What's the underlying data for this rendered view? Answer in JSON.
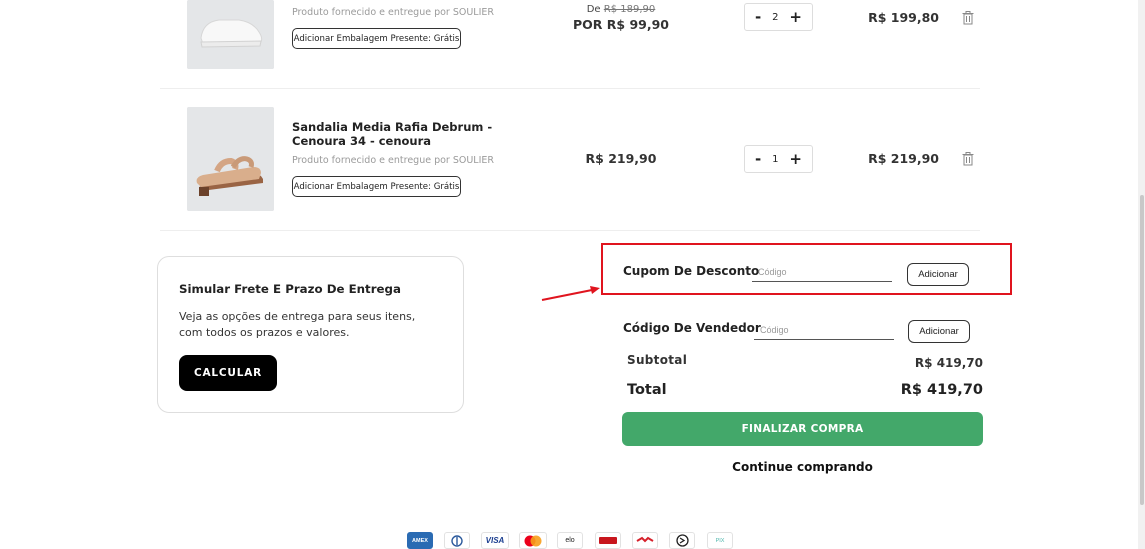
{
  "cart": {
    "items": [
      {
        "name": "",
        "seller": "Produto fornecido e entregue por SOULIER",
        "gift_button": "Adicionar Embalagem Presente: Grátis",
        "old_price_prefix": "De",
        "old_price": "R$ 189,90",
        "price": "POR R$ 99,90",
        "quantity": "2",
        "total": "R$ 199,80"
      },
      {
        "name": "Sandalia Media Rafia Debrum - Cenoura 34 - cenoura",
        "seller": "Produto fornecido e entregue por SOULIER",
        "gift_button": "Adicionar Embalagem Presente: Grátis",
        "price": "R$ 219,90",
        "quantity": "1",
        "total": "R$ 219,90"
      }
    ],
    "qty_minus": "-",
    "qty_plus": "+"
  },
  "shipping": {
    "title": "Simular Frete E Prazo De Entrega",
    "description": "Veja as opções de entrega para seus itens, com todos os prazos e valores.",
    "button": "CALCULAR"
  },
  "coupon": {
    "label": "Cupom De Desconto",
    "placeholder": "Código",
    "button": "Adicionar"
  },
  "seller_code": {
    "label": "Código De Vendedor",
    "placeholder": "Código",
    "button": "Adicionar"
  },
  "summary": {
    "subtotal_label": "Subtotal",
    "subtotal_value": "R$ 419,70",
    "total_label": "Total",
    "total_value": "R$ 419,70",
    "checkout_button": "FINALIZAR COMPRA",
    "continue_link": "Continue comprando"
  },
  "payment_methods": [
    {
      "icon": "amex-icon",
      "label": "AMEX"
    },
    {
      "icon": "diners-icon",
      "label": ""
    },
    {
      "icon": "visa-icon",
      "label": "VISA"
    },
    {
      "icon": "mastercard-icon",
      "label": ""
    },
    {
      "icon": "elo-icon",
      "label": "elo"
    },
    {
      "icon": "hipercard-icon",
      "label": ""
    },
    {
      "icon": "aura-icon",
      "label": ""
    },
    {
      "icon": "boleto-icon",
      "label": ""
    },
    {
      "icon": "pix-icon",
      "label": "PIX"
    }
  ],
  "colors": {
    "annotation_red": "#e0141e",
    "checkout_green": "#43a86a",
    "calc_black": "#000000"
  }
}
